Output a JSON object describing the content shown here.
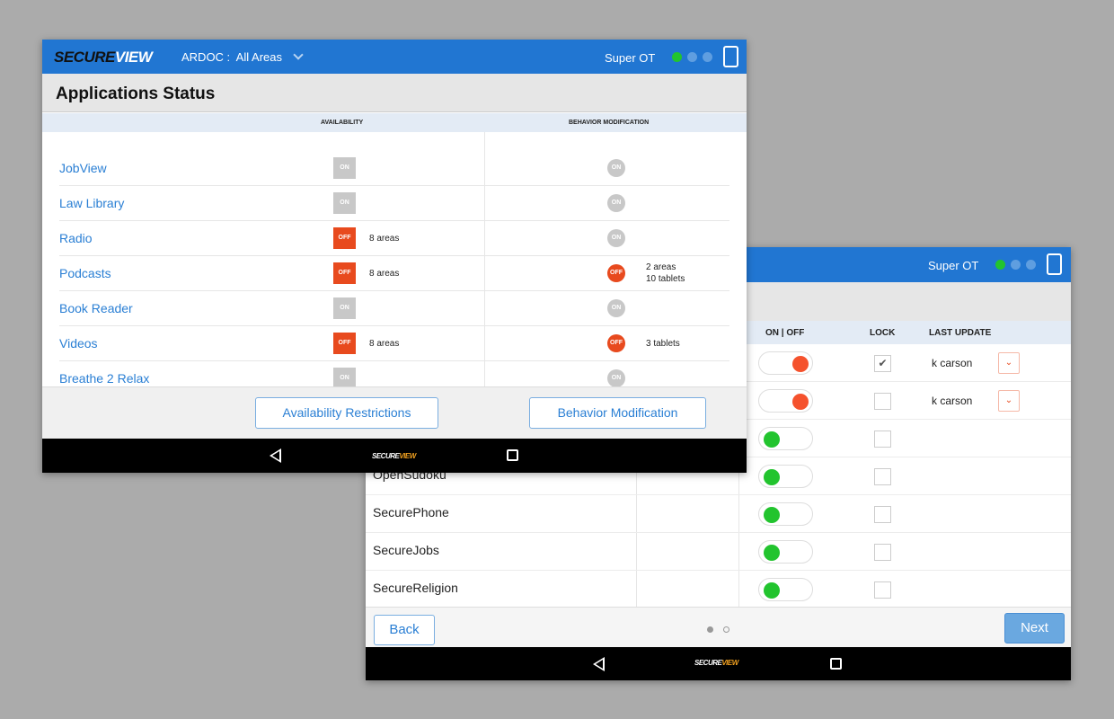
{
  "colors": {
    "header": "#2176d2",
    "on_gray": "#c8c8c8",
    "off_red": "#e84a1e",
    "green": "#22c42e",
    "toggle_off_knob": "#f5522d"
  },
  "front": {
    "logo": {
      "part1": "SECURE",
      "part2": "VIEW"
    },
    "facility": "ARDOC :  All Areas",
    "facility_icon": "chevron-down-icon",
    "user": "Super OT",
    "title": "Applications Status",
    "col_availability": "AVAILABILITY",
    "col_behavior": "BEHAVIOR MODIFICATION",
    "rows": [
      {
        "name": "JobView",
        "avail": "ON",
        "avail_note": "",
        "bm": "ON",
        "bm_note1": "",
        "bm_note2": ""
      },
      {
        "name": "Law Library",
        "avail": "ON",
        "avail_note": "",
        "bm": "ON",
        "bm_note1": "",
        "bm_note2": ""
      },
      {
        "name": "Radio",
        "avail": "OFF",
        "avail_note": "8 areas",
        "bm": "ON",
        "bm_note1": "",
        "bm_note2": ""
      },
      {
        "name": "Podcasts",
        "avail": "OFF",
        "avail_note": "8 areas",
        "bm": "OFF",
        "bm_note1": "2 areas",
        "bm_note2": "10 tablets"
      },
      {
        "name": "Book Reader",
        "avail": "ON",
        "avail_note": "",
        "bm": "ON",
        "bm_note1": "",
        "bm_note2": ""
      },
      {
        "name": "Videos",
        "avail": "OFF",
        "avail_note": "8 areas",
        "bm": "OFF",
        "bm_note1": "3 tablets",
        "bm_note2": ""
      },
      {
        "name": "Breathe 2 Relax",
        "avail": "ON",
        "avail_note": "",
        "bm": "ON",
        "bm_note1": "",
        "bm_note2": ""
      }
    ],
    "btn_availability": "Availability Restrictions",
    "btn_behavior": "Behavior Modification",
    "nav_logo": {
      "part1": "SECURE",
      "part2": "VIEW"
    }
  },
  "back": {
    "user": "Super OT",
    "col_onoff": "ON | OFF",
    "col_lock": "LOCK",
    "col_last_update": "LAST UPDATE",
    "rows": [
      {
        "name": "",
        "on": false,
        "locked": true,
        "updated_by": "k carson"
      },
      {
        "name": "",
        "on": false,
        "locked": false,
        "updated_by": "k carson"
      },
      {
        "name": "",
        "on": true,
        "locked": false,
        "updated_by": ""
      },
      {
        "name": "OpenSudoku",
        "on": true,
        "locked": false,
        "updated_by": ""
      },
      {
        "name": "SecurePhone",
        "on": true,
        "locked": false,
        "updated_by": ""
      },
      {
        "name": "SecureJobs",
        "on": true,
        "locked": false,
        "updated_by": ""
      },
      {
        "name": "SecureReligion",
        "on": true,
        "locked": false,
        "updated_by": ""
      }
    ],
    "btn_back": "Back",
    "btn_next": "Next",
    "page_indicator": {
      "current": 1,
      "total": 2
    },
    "nav_logo": {
      "part1": "SECURE",
      "part2": "VIEW"
    }
  }
}
